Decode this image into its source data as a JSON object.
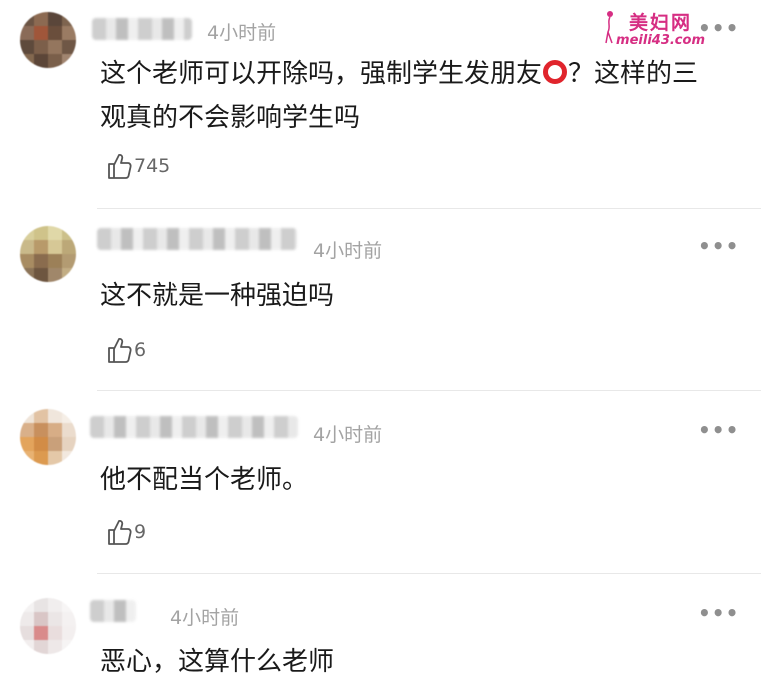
{
  "watermark": {
    "logo": "美妇网",
    "url": "meili43.com"
  },
  "comments": [
    {
      "time": "4小时前",
      "text_before": "这个老师可以开除吗，强制学生发朋友",
      "text_after": "？这样的三观真的不会影响学生吗",
      "likes": "745",
      "more": "•••"
    },
    {
      "time": "4小时前",
      "text": "这不就是一种强迫吗",
      "likes": "6",
      "more": "•••"
    },
    {
      "time": "4小时前",
      "text": "他不配当个老师。",
      "likes": "9",
      "more": "•••"
    },
    {
      "time": "4小时前",
      "text": "恶心，这算什么老师",
      "more": "•••"
    }
  ]
}
